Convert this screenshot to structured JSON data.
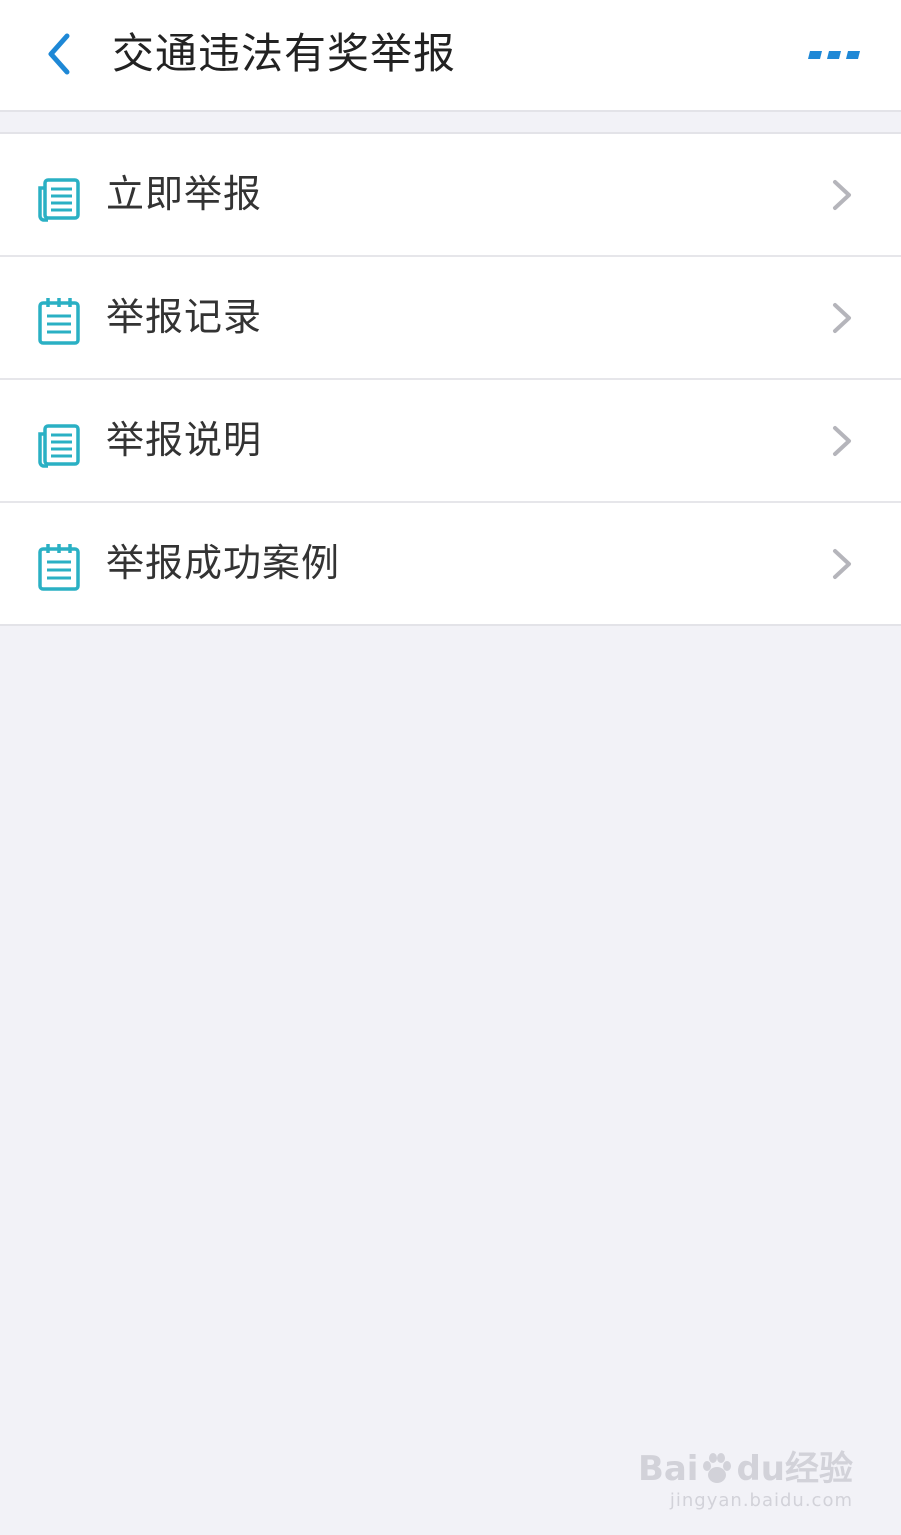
{
  "header": {
    "title": "交通违法有奖举报",
    "back_icon": "chevron-left-icon",
    "more_icon": "more-dots-icon"
  },
  "menu": {
    "items": [
      {
        "label": "立即举报",
        "icon": "document-list-icon"
      },
      {
        "label": "举报记录",
        "icon": "notepad-icon"
      },
      {
        "label": "举报说明",
        "icon": "document-list-icon"
      },
      {
        "label": "举报成功案例",
        "icon": "notepad-icon"
      }
    ]
  },
  "watermark": {
    "brand_left": "Bai",
    "brand_right": "du",
    "brand_suffix": "经验",
    "site": "jingyan.baidu.com"
  },
  "colors": {
    "accent": "#1e88d6",
    "icon_teal": "#2ab0c4",
    "background": "#f2f2f7",
    "chevron": "#b5b5bb"
  }
}
